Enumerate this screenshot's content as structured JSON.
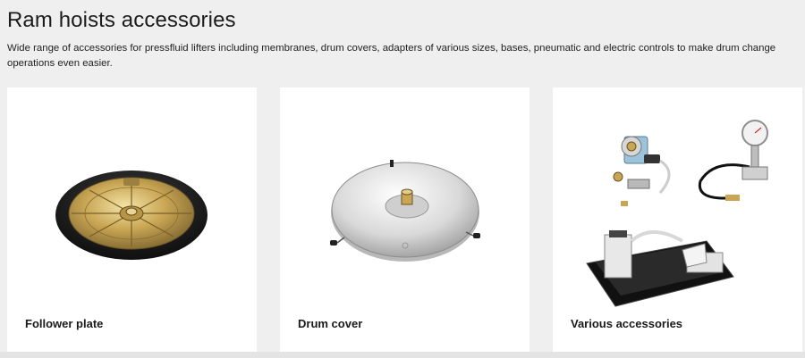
{
  "header": {
    "title": "Ram hoists accessories",
    "description": "Wide range of accessories for pressfluid lifters including membranes, drum covers, adapters of various sizes, bases, pneumatic and electric controls to make drum change operations even easier."
  },
  "cards": [
    {
      "label": "Follower plate",
      "image_icon": "follower-plate-image"
    },
    {
      "label": "Drum cover",
      "image_icon": "drum-cover-image"
    },
    {
      "label": "Various accessories",
      "image_icon": "various-accessories-image"
    }
  ],
  "colors": {
    "background": "#efefef",
    "card": "#ffffff",
    "text": "#1a1a1a"
  }
}
